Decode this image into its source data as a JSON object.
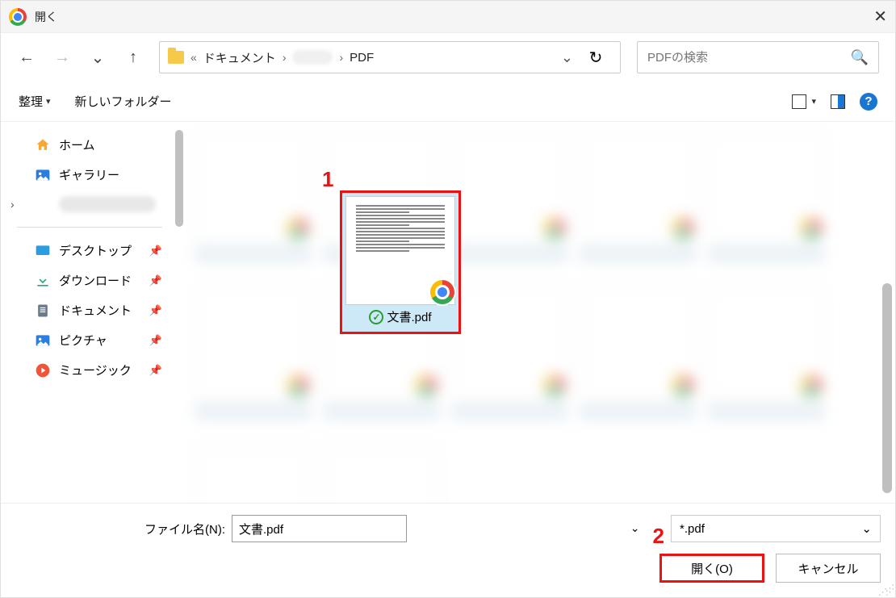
{
  "window": {
    "title": "開く"
  },
  "breadcrumb": {
    "root": "ドキュメント",
    "leaf": "PDF",
    "chev_separator": "›",
    "double_chev": "«"
  },
  "search": {
    "placeholder": "PDFの検索"
  },
  "toolbar": {
    "organize": "整理",
    "organize_caret": "▾",
    "new_folder": "新しいフォルダー"
  },
  "sidebar": {
    "home": "ホーム",
    "gallery": "ギャラリー",
    "desktop": "デスクトップ",
    "downloads": "ダウンロード",
    "documents": "ドキュメント",
    "pictures": "ピクチャ",
    "music": "ミュージック"
  },
  "selected": {
    "filename": "文書.pdf"
  },
  "footer": {
    "filename_label": "ファイル名(N):",
    "filename_value": "文書.pdf",
    "filter": "*.pdf",
    "open": "開く(O)",
    "cancel": "キャンセル"
  },
  "annotations": {
    "one": "1",
    "two": "2"
  }
}
